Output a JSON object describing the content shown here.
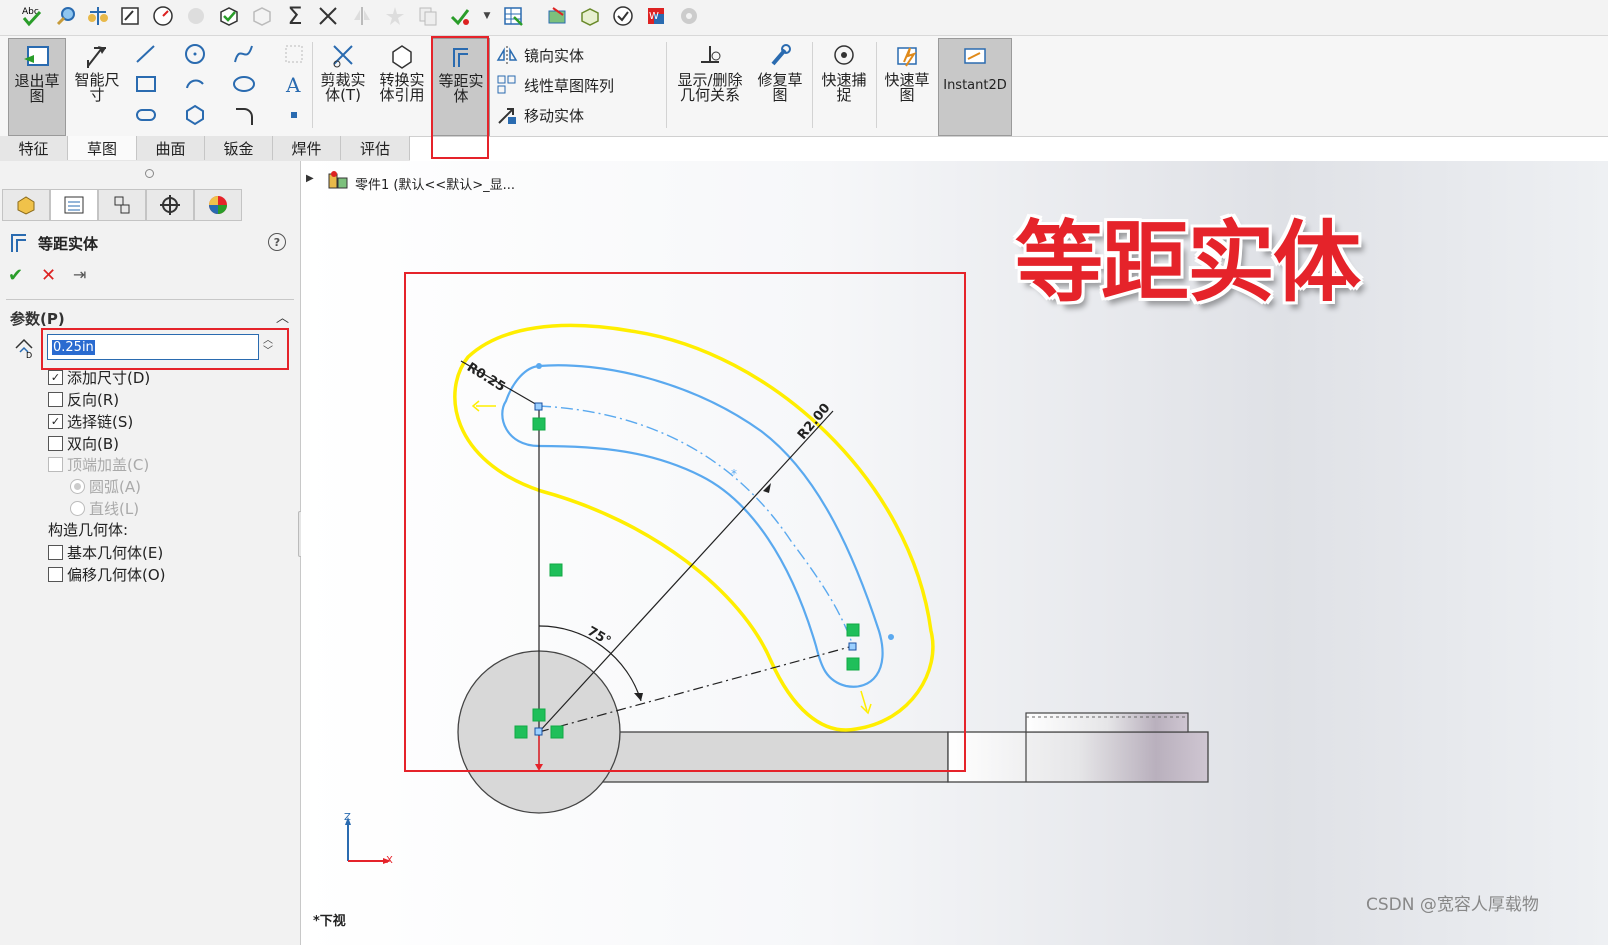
{
  "quick_access": {
    "icons": [
      "spell-check-icon",
      "magnifier-icon",
      "balance-icon",
      "sketch-icon",
      "gauge-icon",
      "stress-icon",
      "check-cube-icon",
      "cube-icon",
      "sum-icon",
      "intersect-icon",
      "mirror-icon",
      "star-icon",
      "copy-icon",
      "verify-icon",
      "dropdown-icon",
      "table-icon",
      "layers-icon",
      "cube-stack-icon",
      "check-circle-icon",
      "word-icon",
      "gear-icon"
    ]
  },
  "ribbon": {
    "exit_sketch": "退出草图",
    "smart_dimension": "智能尺寸",
    "trim_entities": "剪裁实体(T)",
    "convert_entities": "转换实体引用",
    "offset_entities": "等距实体",
    "mirror_entities": "镜向实体",
    "linear_pattern": "线性草图阵列",
    "move_entities": "移动实体",
    "show_relations": "显示/删除几何关系",
    "repair_sketch": "修复草图",
    "quick_snaps": "快速捕捉",
    "rapid_sketch": "快速草图",
    "instant2d": "Instant2D"
  },
  "tabs": [
    "特征",
    "草图",
    "曲面",
    "钣金",
    "焊件",
    "评估"
  ],
  "tree": {
    "label": "零件1 (默认<<默认>_显..."
  },
  "property_manager": {
    "title": "等距实体",
    "section": "参数(P)",
    "distance_value": "0.25in",
    "options": [
      {
        "label": "添加尺寸(D)",
        "checked": true,
        "disabled": false
      },
      {
        "label": "反向(R)",
        "checked": false,
        "disabled": false
      },
      {
        "label": "选择链(S)",
        "checked": true,
        "disabled": false
      },
      {
        "label": "双向(B)",
        "checked": false,
        "disabled": false
      },
      {
        "label": "顶端加盖(C)",
        "checked": false,
        "disabled": true
      }
    ],
    "radio_arc": "圆弧(A)",
    "radio_line": "直线(L)",
    "construction_heading": "构造几何体:",
    "base_geometry": "基本几何体(E)",
    "offset_geometry": "偏移几何体(O)"
  },
  "sketch": {
    "dim_radius_small": "R0.25",
    "dim_radius_large": "R2.00",
    "dim_angle": "75°",
    "axis_z": "Z",
    "axis_x": "X"
  },
  "overlay_title": "等距实体",
  "bottom_label": "*下视",
  "watermark": "CSDN @宽容人厚载物",
  "colors": {
    "highlight_red": "#e5232a",
    "offset_yellow": "#ffee00",
    "sketch_blue": "#5aa9ef"
  }
}
